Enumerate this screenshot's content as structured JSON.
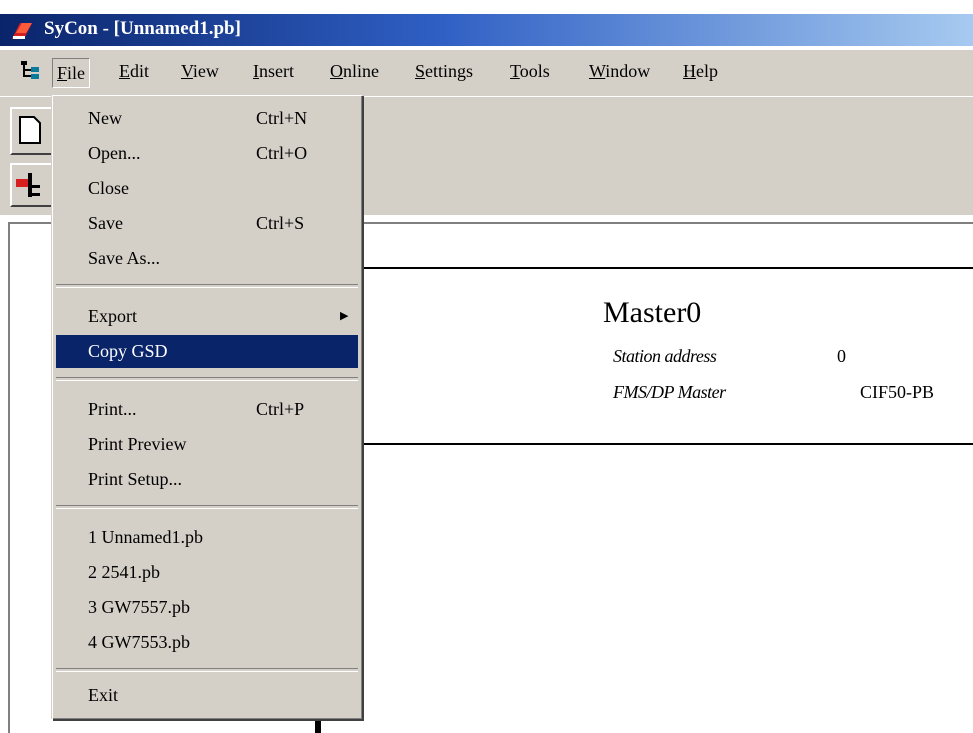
{
  "window": {
    "title": "SyCon - [Unnamed1.pb]",
    "app_icon": "sycon-app-icon"
  },
  "menubar": {
    "items": [
      {
        "label": "File",
        "mnemonic": "F"
      },
      {
        "label": "Edit",
        "mnemonic": "E"
      },
      {
        "label": "View",
        "mnemonic": "V"
      },
      {
        "label": "Insert",
        "mnemonic": "I"
      },
      {
        "label": "Online",
        "mnemonic": "O"
      },
      {
        "label": "Settings",
        "mnemonic": "S"
      },
      {
        "label": "Tools",
        "mnemonic": "T"
      },
      {
        "label": "Window",
        "mnemonic": "W"
      },
      {
        "label": "Help",
        "mnemonic": "H"
      }
    ],
    "active": "File"
  },
  "file_menu": {
    "items": [
      {
        "label": "New",
        "shortcut": "Ctrl+N"
      },
      {
        "label": "Open...",
        "shortcut": "Ctrl+O"
      },
      {
        "label": "Close",
        "shortcut": ""
      },
      {
        "label": "Save",
        "shortcut": "Ctrl+S"
      },
      {
        "label": "Save As...",
        "shortcut": ""
      },
      {
        "label": "Export",
        "shortcut": "",
        "submenu": true
      },
      {
        "label": "Copy GSD",
        "shortcut": "",
        "selected": true
      },
      {
        "label": "Print...",
        "shortcut": "Ctrl+P"
      },
      {
        "label": "Print Preview",
        "shortcut": ""
      },
      {
        "label": "Print Setup...",
        "shortcut": ""
      },
      {
        "label": "1 Unnamed1.pb",
        "shortcut": ""
      },
      {
        "label": "2 2541.pb",
        "shortcut": ""
      },
      {
        "label": "3 GW7557.pb",
        "shortcut": ""
      },
      {
        "label": "4 GW7553.pb",
        "shortcut": ""
      },
      {
        "label": "Exit",
        "shortcut": ""
      }
    ]
  },
  "master": {
    "name": "Master0",
    "station_label": "Station address",
    "station_value": "0",
    "type_label": "FMS/DP Master",
    "type_value": "CIF50-PB"
  },
  "colors": {
    "title_gradient_start": "#0a246a",
    "title_gradient_end": "#a6caf0",
    "selection": "#0a246a",
    "chrome": "#d4d0c8"
  }
}
